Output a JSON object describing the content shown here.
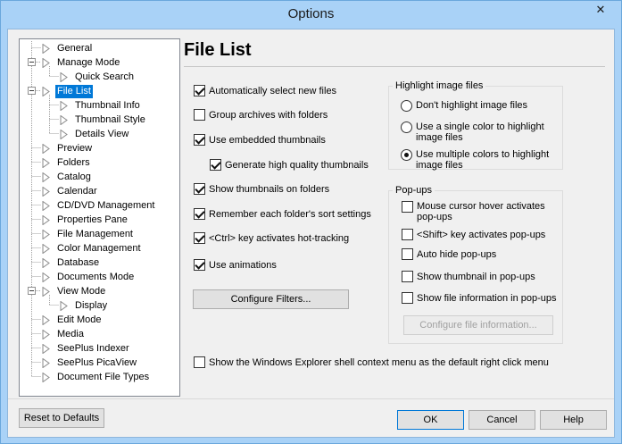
{
  "window": {
    "title": "Options",
    "close_glyph": "✕"
  },
  "tree": {
    "items": [
      {
        "label": "General"
      },
      {
        "label": "Manage Mode"
      },
      {
        "label": "Quick Search"
      },
      {
        "label": "File List"
      },
      {
        "label": "Thumbnail Info"
      },
      {
        "label": "Thumbnail Style"
      },
      {
        "label": "Details View"
      },
      {
        "label": "Preview"
      },
      {
        "label": "Folders"
      },
      {
        "label": "Catalog"
      },
      {
        "label": "Calendar"
      },
      {
        "label": "CD/DVD Management"
      },
      {
        "label": "Properties Pane"
      },
      {
        "label": "File Management"
      },
      {
        "label": "Color Management"
      },
      {
        "label": "Database"
      },
      {
        "label": "Documents Mode"
      },
      {
        "label": "View Mode"
      },
      {
        "label": "Display"
      },
      {
        "label": "Edit Mode"
      },
      {
        "label": "Media"
      },
      {
        "label": "SeePlus Indexer"
      },
      {
        "label": "SeePlus PicaView"
      },
      {
        "label": "Document File Types"
      }
    ],
    "selected": "File List"
  },
  "panel": {
    "title": "File List",
    "options": [
      {
        "label": "Automatically select new files",
        "checked": true
      },
      {
        "label": "Group archives with folders",
        "checked": false
      },
      {
        "label": "Use embedded thumbnails",
        "checked": true
      },
      {
        "label": "Generate high quality thumbnails",
        "checked": true
      },
      {
        "label": "Show thumbnails on folders",
        "checked": true
      },
      {
        "label": "Remember each folder's sort settings",
        "checked": true
      },
      {
        "label": "<Ctrl> key activates hot-tracking",
        "checked": true
      },
      {
        "label": "Use animations",
        "checked": true
      }
    ],
    "configure_filters": "Configure Filters...",
    "shell_menu": {
      "label": "Show the Windows Explorer shell context menu as the default right click menu",
      "checked": false
    },
    "highlight": {
      "title": "Highlight image files",
      "options": [
        {
          "label": "Don't highlight image files",
          "selected": false
        },
        {
          "label": "Use a single color to highlight image files",
          "selected": false
        },
        {
          "label": "Use multiple colors to highlight image files",
          "selected": true
        }
      ]
    },
    "popups": {
      "title": "Pop-ups",
      "options": [
        {
          "label": "Mouse cursor hover activates pop-ups",
          "checked": false
        },
        {
          "label": "<Shift> key activates pop-ups",
          "checked": false
        },
        {
          "label": "Auto hide pop-ups",
          "checked": false
        },
        {
          "label": "Show thumbnail in pop-ups",
          "checked": false
        },
        {
          "label": "Show file information in pop-ups",
          "checked": false
        }
      ],
      "configure_info": "Configure file information..."
    }
  },
  "footer": {
    "reset": "Reset to Defaults",
    "ok": "OK",
    "cancel": "Cancel",
    "help": "Help"
  }
}
